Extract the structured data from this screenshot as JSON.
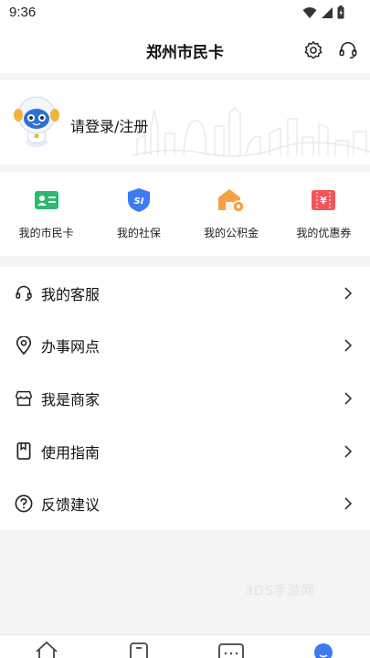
{
  "status_bar": {
    "time": "9:36"
  },
  "header": {
    "title": "郑州市民卡",
    "icons": [
      "settings-gear-icon",
      "customer-service-headset-icon"
    ]
  },
  "profile": {
    "login_text": "请登录/注册",
    "avatar": "robot-mascot-avatar"
  },
  "quick_actions": [
    {
      "label": "我的市民卡",
      "icon": "citizen-card-icon",
      "color": "#2eb872"
    },
    {
      "label": "我的社保",
      "icon": "social-security-shield-icon",
      "color": "#3d7bf5"
    },
    {
      "label": "我的公积金",
      "icon": "housing-fund-house-icon",
      "color": "#f5a142"
    },
    {
      "label": "我的优惠券",
      "icon": "coupon-ticket-icon",
      "color": "#f2565a"
    }
  ],
  "menu": [
    {
      "label": "我的客服",
      "icon": "headset-icon"
    },
    {
      "label": "办事网点",
      "icon": "location-pin-icon"
    },
    {
      "label": "我是商家",
      "icon": "store-icon"
    },
    {
      "label": "使用指南",
      "icon": "guide-book-icon"
    },
    {
      "label": "反馈建议",
      "icon": "help-question-icon"
    }
  ],
  "watermark": "3DS手游网",
  "tab_bar": {
    "items": [
      "home-tab-icon",
      "card-tab-icon",
      "services-tab-icon",
      "profile-tab-icon"
    ],
    "active_color": "#3d7bf5"
  }
}
